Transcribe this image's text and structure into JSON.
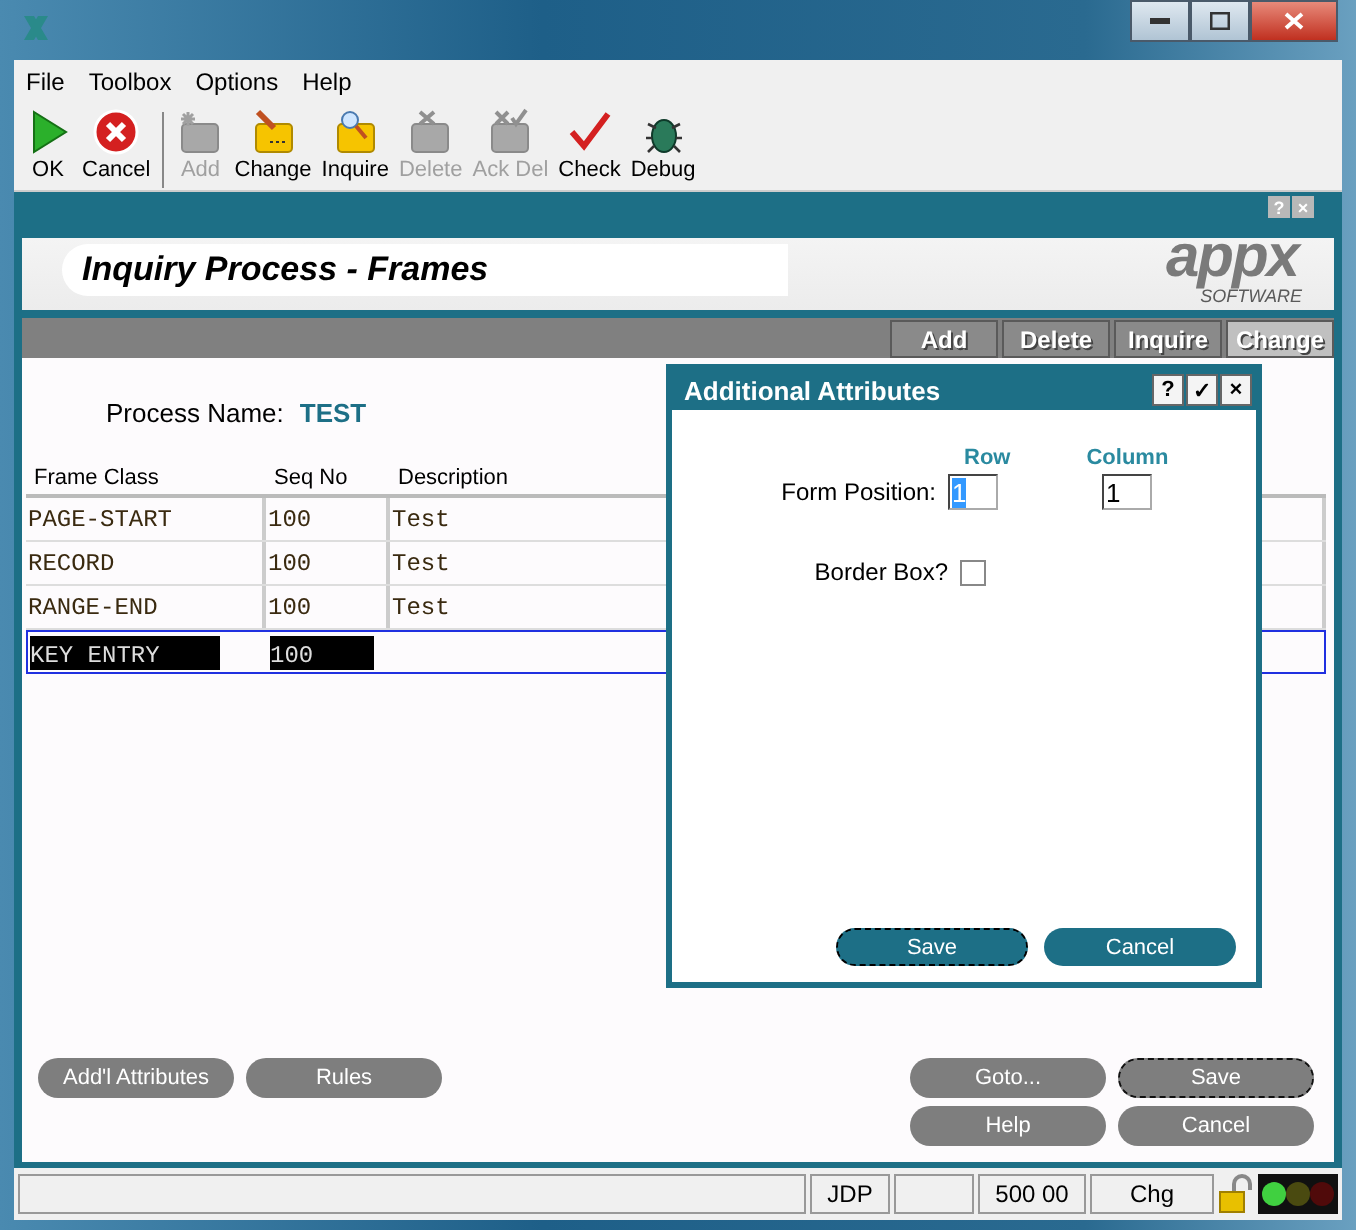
{
  "menu": [
    "File",
    "Toolbox",
    "Options",
    "Help"
  ],
  "toolbar": [
    {
      "label": "OK",
      "kind": "ok",
      "disabled": false
    },
    {
      "label": "Cancel",
      "kind": "cancel",
      "disabled": false
    },
    {
      "label": "Add",
      "kind": "add",
      "disabled": true
    },
    {
      "label": "Change",
      "kind": "change",
      "disabled": false
    },
    {
      "label": "Inquire",
      "kind": "inquire",
      "disabled": false
    },
    {
      "label": "Delete",
      "kind": "delete",
      "disabled": true
    },
    {
      "label": "Ack Del",
      "kind": "ackdel",
      "disabled": true
    },
    {
      "label": "Check",
      "kind": "check",
      "disabled": false
    },
    {
      "label": "Debug",
      "kind": "debug",
      "disabled": false
    }
  ],
  "frame_buttons": [
    "?",
    "×"
  ],
  "frame": {
    "title": "Inquiry Process - Frames",
    "logo": {
      "word": "appx",
      "tagline": "SOFTWARE"
    },
    "tabs": [
      {
        "label": "Add",
        "selected": false
      },
      {
        "label": "Delete",
        "selected": false
      },
      {
        "label": "Inquire",
        "selected": false
      },
      {
        "label": "Change",
        "selected": true
      }
    ]
  },
  "process_name": {
    "label": "Process Name:",
    "value": "TEST"
  },
  "table": {
    "columns": [
      "Frame Class",
      "Seq No",
      "Description"
    ],
    "rows": [
      {
        "frame_class": "PAGE-START",
        "seq_no": "100",
        "description": "Test",
        "selected": false
      },
      {
        "frame_class": "RECORD",
        "seq_no": "100",
        "description": "Test",
        "selected": false
      },
      {
        "frame_class": "RANGE-END",
        "seq_no": "100",
        "description": "Test",
        "selected": false
      },
      {
        "frame_class": "KEY ENTRY",
        "seq_no": "100",
        "selected": true
      }
    ]
  },
  "buttons_left": [
    {
      "label": "Add'l Attributes",
      "focused": false
    },
    {
      "label": "Rules",
      "focused": false
    }
  ],
  "buttons_right": [
    {
      "label": "Goto...",
      "focused": false
    },
    {
      "label": "Save",
      "focused": true
    },
    {
      "label": "Help",
      "focused": false
    },
    {
      "label": "Cancel",
      "focused": false
    }
  ],
  "dialog": {
    "title": "Additional Attributes",
    "header_buttons": [
      "?",
      "✓",
      "×"
    ],
    "column_headers": [
      "Row",
      "Column"
    ],
    "form_position": {
      "label": "Form Position:",
      "fields": [
        {
          "value": "1",
          "selected": true
        },
        {
          "value": "1",
          "selected": false
        }
      ]
    },
    "border_box": {
      "label": "Border Box?",
      "checked": false
    },
    "buttons": [
      {
        "label": "Save",
        "focused": true
      },
      {
        "label": "Cancel",
        "focused": false
      }
    ]
  },
  "status_bar": [
    "JDP",
    "500 00",
    "Chg"
  ]
}
